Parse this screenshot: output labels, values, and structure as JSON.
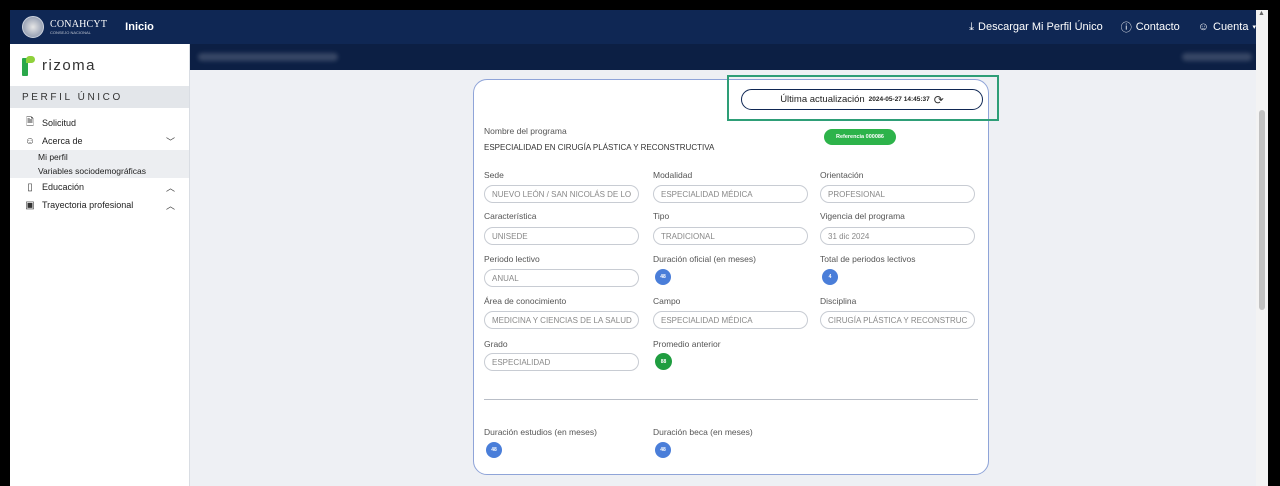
{
  "topbar": {
    "org_name": "CONAHCYT",
    "org_sub": "CONSEJO NACIONAL",
    "inicio": "Inicio",
    "download": "Descargar Mi Perfil Único",
    "contact": "Contacto",
    "account": "Cuenta"
  },
  "sidebar": {
    "brand": "rizoma",
    "section": "PERFIL ÚNICO",
    "items": [
      {
        "label": "Solicitud",
        "icon": "document-icon"
      },
      {
        "label": "Acerca de",
        "icon": "user-icon"
      },
      {
        "label": "Mi perfil"
      },
      {
        "label": "Variables sociodemográficas"
      },
      {
        "label": "Educación",
        "icon": "book-icon"
      },
      {
        "label": "Trayectoria profesional",
        "icon": "badge-icon"
      }
    ]
  },
  "card": {
    "update_label": "Última actualización",
    "update_ts": "2024-05-27 14:45:37",
    "program_label": "Nombre del programa",
    "program_value": "ESPECIALIDAD EN CIRUGÍA PLÁSTICA Y RECONSTRUCTIVA",
    "referencia": "Referencia 000086",
    "sede_label": "Sede",
    "sede_value": "NUEVO LEÓN / SAN NICOLÁS DE LO",
    "modalidad_label": "Modalidad",
    "modalidad_value": "ESPECIALIDAD MÉDICA",
    "orientacion_label": "Orientación",
    "orientacion_value": "PROFESIONAL",
    "caracteristica_label": "Característica",
    "caracteristica_value": "UNISEDE",
    "tipo_label": "Tipo",
    "tipo_value": "TRADICIONAL",
    "vigencia_label": "Vigencia del programa",
    "vigencia_value": "31 dic 2024",
    "periodo_label": "Periodo lectivo",
    "periodo_value": "ANUAL",
    "duracion_label": "Duración oficial (en meses)",
    "duracion_value": "48",
    "total_label": "Total de periodos lectivos",
    "total_value": "4",
    "area_label": "Área de conocimiento",
    "area_value": "MEDICINA Y CIENCIAS DE LA SALUD",
    "campo_label": "Campo",
    "campo_value": "ESPECIALIDAD MÉDICA",
    "disciplina_label": "Disciplina",
    "disciplina_value": "CIRUGÍA PLÁSTICA Y RECONSTRUC",
    "grado_label": "Grado",
    "grado_value": "ESPECIALIDAD",
    "promedio_label": "Promedio anterior",
    "promedio_value": "88",
    "dur_estudios_label": "Duración estudios (en meses)",
    "dur_estudios_value": "48",
    "dur_beca_label": "Duración beca (en meses)",
    "dur_beca_value": "48"
  }
}
